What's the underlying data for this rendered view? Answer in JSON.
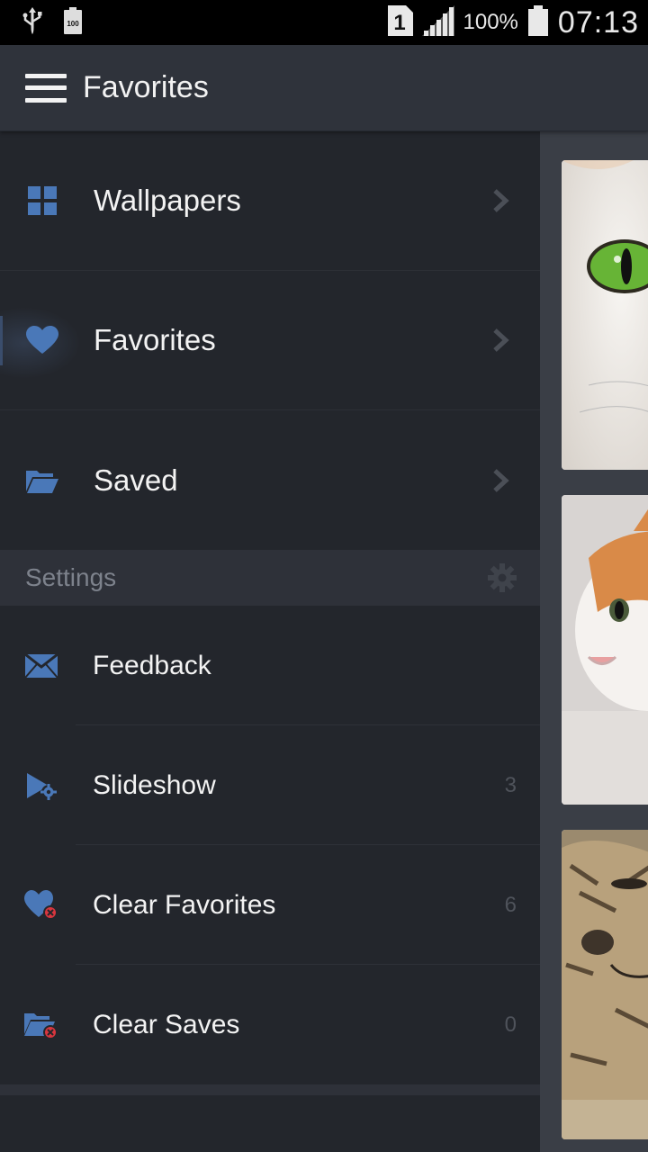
{
  "status_bar": {
    "left_icons": [
      "usb-icon",
      "battery-saver-icon"
    ],
    "sim_slot": "1",
    "battery_percent": "100%",
    "time": "07:13"
  },
  "app_bar": {
    "title": "Favorites",
    "menu_icon": "hamburger-menu-icon"
  },
  "drawer": {
    "nav_items": [
      {
        "label": "Wallpapers",
        "icon": "grid-icon",
        "active": false
      },
      {
        "label": "Favorites",
        "icon": "heart-icon",
        "active": true
      },
      {
        "label": "Saved",
        "icon": "folder-open-icon",
        "active": false
      }
    ],
    "settings_header": {
      "label": "Settings",
      "icon": "gear-icon"
    },
    "settings_items": [
      {
        "label": "Feedback",
        "icon": "envelope-icon",
        "count": ""
      },
      {
        "label": "Slideshow",
        "icon": "play-gear-icon",
        "count": "3"
      },
      {
        "label": "Clear Favorites",
        "icon": "heart-remove-icon",
        "count": "6"
      },
      {
        "label": "Clear Saves",
        "icon": "folder-remove-icon",
        "count": "0"
      }
    ]
  },
  "content": {
    "thumbnails": [
      "cat-green-eye-thumbnail",
      "white-orange-cat-thumbnail",
      "tabby-cat-thumbnail"
    ]
  },
  "colors": {
    "accent_blue": "#4a78b8",
    "drawer_bg": "#23262c",
    "appbar_bg": "#2f333b",
    "section_bg": "#2e3139",
    "remove_red": "#d9363e"
  }
}
